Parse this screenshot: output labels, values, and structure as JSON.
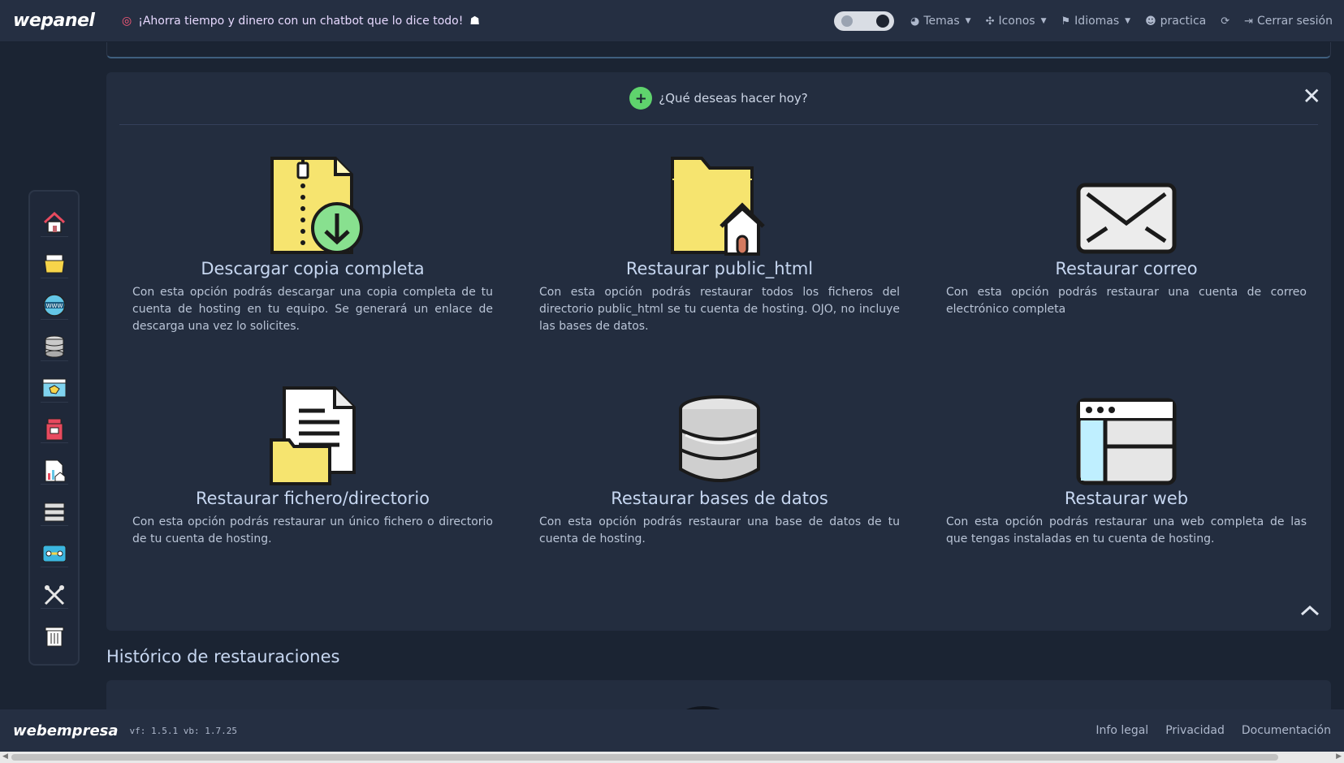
{
  "header": {
    "logo": "wepanel",
    "promo_text": "¡Ahorra tiempo y dinero con un chatbot que lo dice todo!",
    "nav": [
      {
        "label": "Temas",
        "icon": "palette-icon",
        "dropdown": true
      },
      {
        "label": "Iconos",
        "icon": "icons-icon",
        "dropdown": true
      },
      {
        "label": "Idiomas",
        "icon": "flag-icon",
        "dropdown": true
      },
      {
        "label": "practica",
        "icon": "user-gear-icon",
        "dropdown": false
      },
      {
        "label": "Cerrar sesión",
        "icon": "logout-icon",
        "dropdown": false
      }
    ],
    "theme_toggle": "dark"
  },
  "sidebar": {
    "items": [
      {
        "name": "home-icon"
      },
      {
        "name": "file-manager-icon"
      },
      {
        "name": "domains-www-icon"
      },
      {
        "name": "database-icon"
      },
      {
        "name": "web-apps-icon"
      },
      {
        "name": "mailbox-icon"
      },
      {
        "name": "stats-icon"
      },
      {
        "name": "servers-icon"
      },
      {
        "name": "ssh-tunnel-icon"
      },
      {
        "name": "tools-icon"
      },
      {
        "name": "trash-icon"
      }
    ]
  },
  "panel": {
    "title": "¿Qué deseas hacer hoy?",
    "cards": [
      {
        "title": "Descargar copia completa",
        "desc": "Con esta opción podrás descargar una copia completa de tu cuenta de hosting en tu equipo. Se generará un enlace de descarga una vez lo solicites.",
        "icon": "zip-download-icon"
      },
      {
        "title": "Restaurar public_html",
        "desc": "Con esta opción podrás restaurar todos los ficheros del directorio public_html se tu cuenta de hosting. OJO, no incluye las bases de datos.",
        "icon": "folder-home-icon"
      },
      {
        "title": "Restaurar correo",
        "desc": "Con esta opción podrás restaurar una cuenta de correo electrónico completa",
        "icon": "envelope-icon"
      },
      {
        "title": "Restaurar fichero/directorio",
        "desc": "Con esta opción podrás restaurar un único fichero o directorio de tu cuenta de hosting.",
        "icon": "file-folder-icon"
      },
      {
        "title": "Restaurar bases de datos",
        "desc": "Con esta opción podrás restaurar una base de datos de tu cuenta de hosting.",
        "icon": "database-icon"
      },
      {
        "title": "Restaurar web",
        "desc": "Con esta opción podrás restaurar una web completa de las que tengas instaladas en tu cuenta de hosting.",
        "icon": "browser-window-icon"
      }
    ]
  },
  "history": {
    "title": "Histórico de restauraciones"
  },
  "footer": {
    "brand": "webempresa",
    "version": "vf: 1.5.1 vb: 1.7.25",
    "links": [
      "Info legal",
      "Privacidad",
      "Documentación"
    ]
  }
}
